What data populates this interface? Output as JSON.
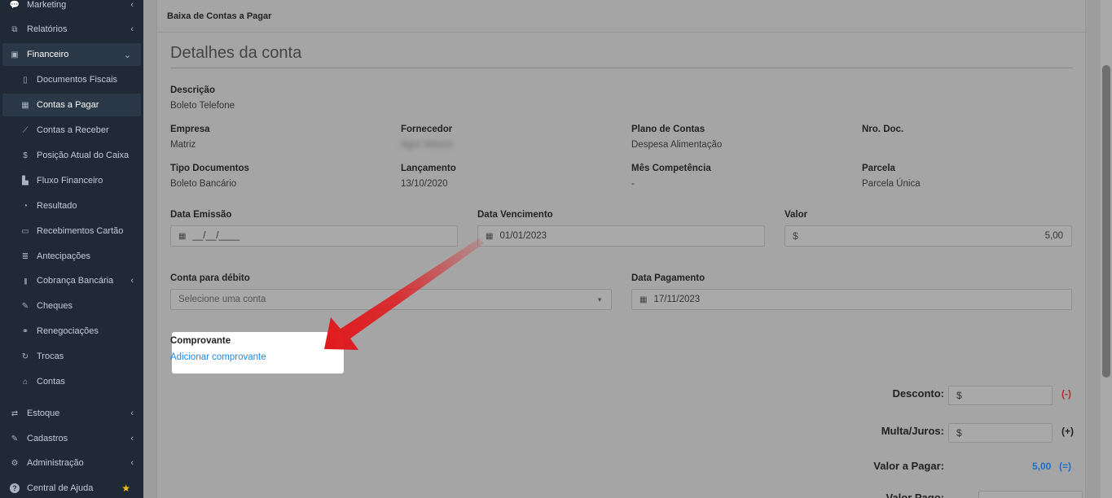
{
  "sidebar": {
    "items": [
      {
        "label": "Marketing",
        "icon": "chat-icon",
        "glyph": "💬",
        "chevron": "‹"
      },
      {
        "label": "Relatórios",
        "icon": "copy-icon",
        "glyph": "⧉",
        "chevron": "‹"
      },
      {
        "label": "Financeiro",
        "icon": "money-icon",
        "glyph": "▣",
        "chevron": "⌄"
      },
      {
        "label": "Documentos Fiscais",
        "icon": "file-icon",
        "glyph": "▯"
      },
      {
        "label": "Contas a Pagar",
        "icon": "calculator-icon",
        "glyph": "▦"
      },
      {
        "label": "Contas a Receber",
        "icon": "line-chart-icon",
        "glyph": "⟋"
      },
      {
        "label": "Posição Atual do Caixa",
        "icon": "dollar-icon",
        "glyph": "$"
      },
      {
        "label": "Fluxo Financeiro",
        "icon": "bar-chart-icon",
        "glyph": "▙"
      },
      {
        "label": "Resultado",
        "icon": "pie-chart-icon",
        "glyph": "◔"
      },
      {
        "label": "Recebimentos Cartão",
        "icon": "credit-card-icon",
        "glyph": "▭"
      },
      {
        "label": "Antecipações",
        "icon": "list-icon",
        "glyph": "≣"
      },
      {
        "label": "Cobrança Bancária",
        "icon": "barcode-icon",
        "glyph": "|||",
        "chevron": "‹"
      },
      {
        "label": "Cheques",
        "icon": "edit-icon",
        "glyph": "✎"
      },
      {
        "label": "Renegociações",
        "icon": "handshake-icon",
        "glyph": "⚭"
      },
      {
        "label": "Trocas",
        "icon": "refresh-icon",
        "glyph": "↻"
      },
      {
        "label": "Contas",
        "icon": "bank-icon",
        "glyph": "⌂"
      },
      {
        "label": "Estoque",
        "icon": "exchange-icon",
        "glyph": "⇄",
        "chevron": "‹"
      },
      {
        "label": "Cadastros",
        "icon": "edit-icon",
        "glyph": "✎",
        "chevron": "‹"
      },
      {
        "label": "Administração",
        "icon": "cogs-icon",
        "glyph": "⚙",
        "chevron": "‹"
      },
      {
        "label": "Central de Ajuda",
        "icon": "help-icon",
        "glyph": "?",
        "badge": "★"
      }
    ]
  },
  "panel": {
    "header": "Baixa de Contas a Pagar",
    "section_title": "Detalhes da conta"
  },
  "fields": {
    "descricao": {
      "label": "Descrição",
      "value": "Boleto Telefone"
    },
    "empresa": {
      "label": "Empresa",
      "value": "Matriz"
    },
    "fornecedor": {
      "label": "Fornecedor",
      "value": "Agro Velucci"
    },
    "plano": {
      "label": "Plano de Contas",
      "value": "Despesa Alimentação"
    },
    "nro_doc": {
      "label": "Nro. Doc.",
      "value": ""
    },
    "tipo_doc": {
      "label": "Tipo Documentos",
      "value": "Boleto Bancário"
    },
    "lancamento": {
      "label": "Lançamento",
      "value": "13/10/2020"
    },
    "mes_comp": {
      "label": "Mês Competência",
      "value": "-"
    },
    "parcela": {
      "label": "Parcela",
      "value": "Parcela Única"
    }
  },
  "inputs": {
    "data_emissao": {
      "label": "Data Emissão",
      "value": "__/__/____"
    },
    "data_vencimento": {
      "label": "Data Vencimento",
      "value": "01/01/2023"
    },
    "valor": {
      "label": "Valor",
      "prefix": "$",
      "value": "5,00"
    },
    "conta_debito": {
      "label": "Conta para débito",
      "placeholder": "Selecione uma conta"
    },
    "data_pagamento": {
      "label": "Data Pagamento",
      "value": "17/11/2023"
    }
  },
  "comprovante": {
    "label": "Comprovante",
    "link": "Adicionar comprovante"
  },
  "totals": {
    "desconto": {
      "label": "Desconto:",
      "prefix": "$",
      "sign": "(-)"
    },
    "multa": {
      "label": "Multa/Juros:",
      "prefix": "$",
      "sign": "(+)"
    },
    "valor_pagar": {
      "label": "Valor a Pagar:",
      "value": "5,00",
      "sign": "(=)"
    },
    "valor_pago": {
      "label": "Valor Pago:"
    }
  },
  "icons": {
    "calendar": "▦",
    "caret": "▼"
  },
  "colors": {
    "sidebar_bg": "#1f2a36",
    "link": "#1e88e5",
    "minus": "#b03030",
    "total": "#1e6fc9",
    "arrow": "#e0191d"
  }
}
